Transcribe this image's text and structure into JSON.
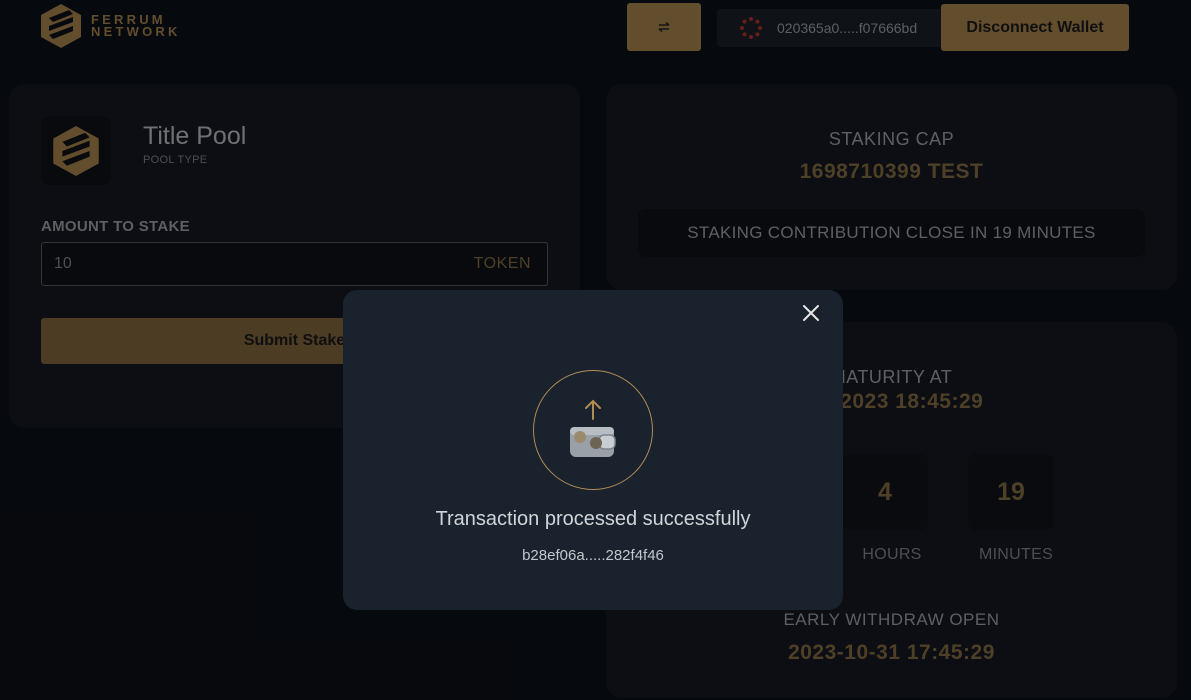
{
  "header": {
    "logo_line1": "FERRUM",
    "logo_line2": "NETWORK",
    "swap_icon": "swap-arrows-icon",
    "wallet_address": "020365a0.....f07666bd",
    "disconnect_label": "Disconnect Wallet"
  },
  "pool": {
    "title": "Title Pool",
    "type": "POOL TYPE",
    "amount_label": "AMOUNT TO STAKE",
    "amount_value": "10",
    "token_label": "TOKEN",
    "submit_label": "Submit Stake"
  },
  "cap": {
    "title": "STAKING CAP",
    "value": "1698710399 TEST",
    "close_text": "STAKING CONTRIBUTION CLOSE IN 19 MINUTES"
  },
  "maturity": {
    "title": "MATURITY AT",
    "value": "ber 2023 18:45:29",
    "hours_value": "4",
    "hours_label": "HOURS",
    "minutes_value": "19",
    "minutes_label": "MINUTES",
    "early_title": "EARLY WITHDRAW OPEN",
    "early_value": "2023-10-31 17:45:29"
  },
  "modal": {
    "message": "Transaction processed successfully",
    "tx_hash": "b28ef06a.....282f4f46"
  },
  "colors": {
    "accent": "#b28d53",
    "background": "#0c1118",
    "card": "#161b23",
    "modal": "#19222d"
  }
}
